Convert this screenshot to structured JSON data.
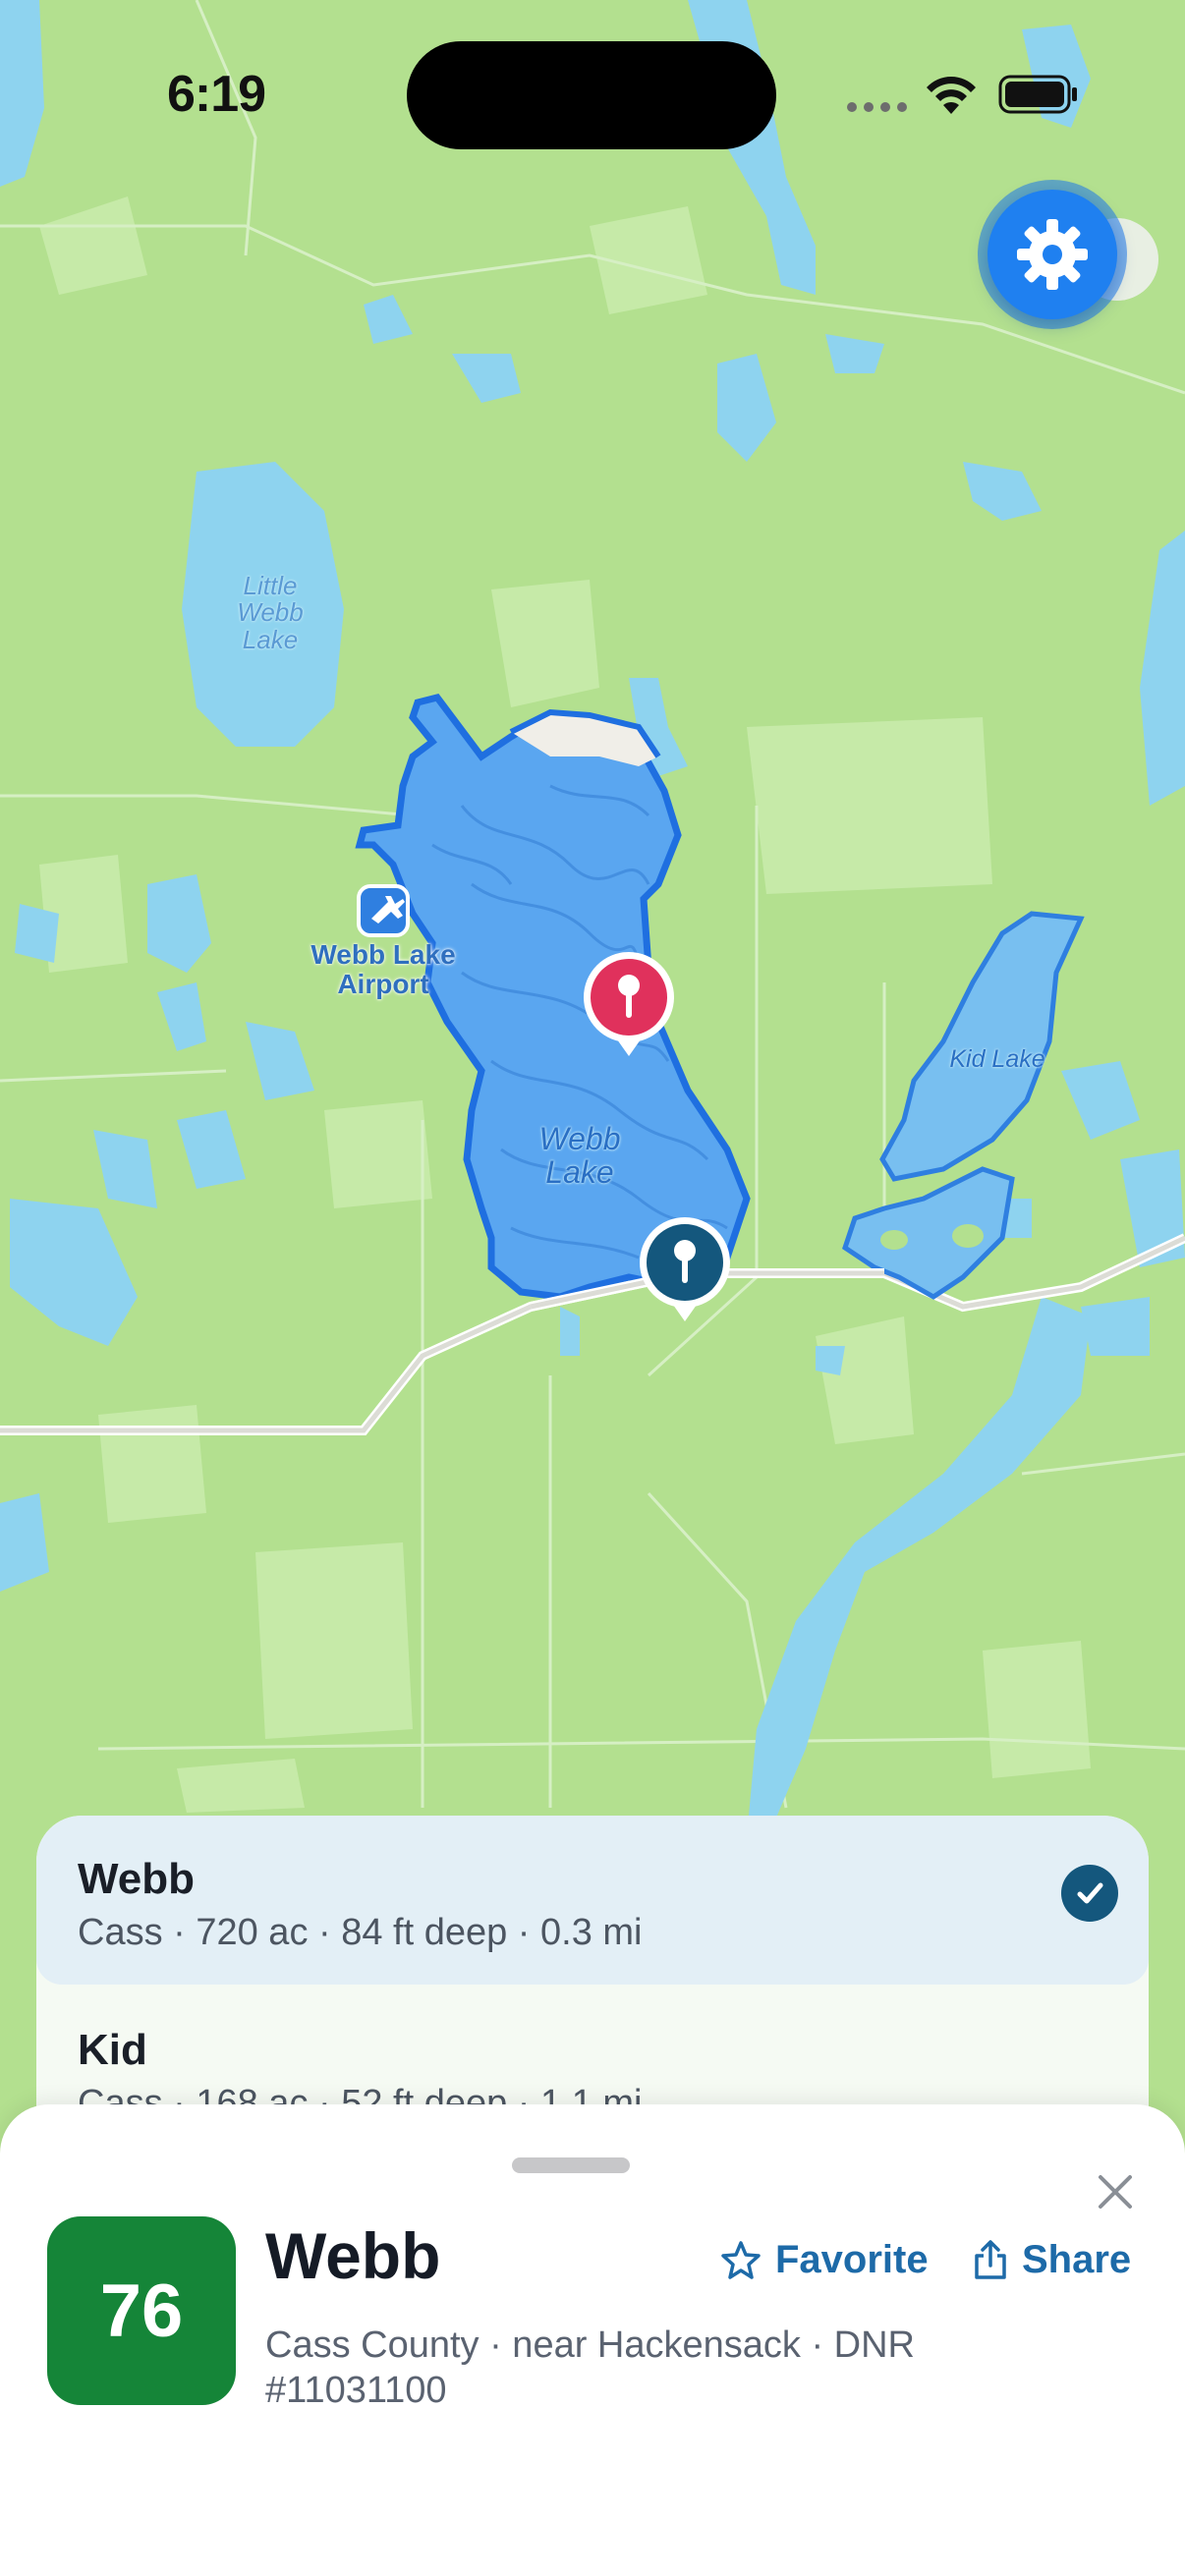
{
  "status_bar": {
    "time": "6:19"
  },
  "map": {
    "labels": {
      "little_webb": "Little\nWebb\nLake",
      "airport": "Webb Lake\nAirport",
      "webb_lake": "Webb\nLake",
      "kid_lake": "Kid Lake"
    },
    "icons": {
      "settings": "gear-icon",
      "airport": "airplane-icon",
      "pin": "location-pin-icon"
    },
    "colors": {
      "land": "#b3e08f",
      "water": "#8ed3ef",
      "selected_lake": "#5aa6f0",
      "selected_outline": "#1f6fe0",
      "pin_selected": "#e0315c",
      "pin_other": "#14577d"
    }
  },
  "lake_list": {
    "items": [
      {
        "name": "Webb",
        "details": "Cass · 720 ac · 84 ft deep · 0.3 mi",
        "selected": true
      },
      {
        "name": "Kid",
        "details": "Cass · 168 ac · 52 ft deep · 1.1 mi",
        "selected": false
      }
    ]
  },
  "detail_sheet": {
    "score": "76",
    "score_color": "#158538",
    "name": "Webb",
    "subtitle": "Cass County · near Hackensack · DNR #11031100",
    "favorite_label": "Favorite",
    "share_label": "Share",
    "accent": "#1d6aa8"
  }
}
